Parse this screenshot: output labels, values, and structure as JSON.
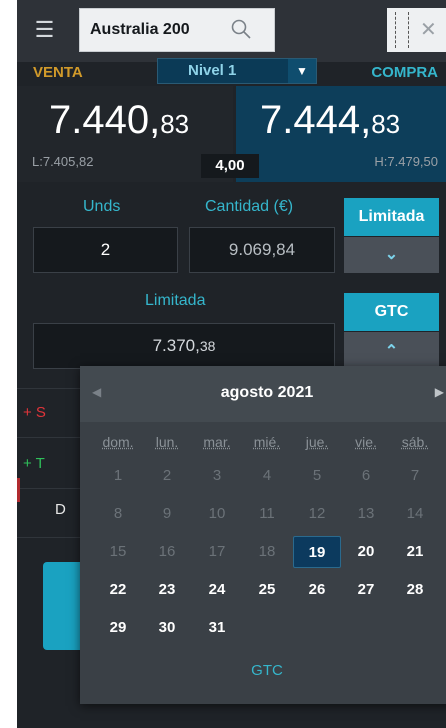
{
  "header": {
    "instrument": "Australia 200"
  },
  "prices": {
    "sell_label": "VENTA",
    "buy_label": "COMPRA",
    "level_label": "Nivel 1",
    "sell_main": "7.440,",
    "sell_small": "83",
    "buy_main": "7.444,",
    "buy_small": "83",
    "low": "L:7.405,82",
    "high": "H:7.479,50",
    "spread": "4,00"
  },
  "form": {
    "units_label": "Unds",
    "units_value": "2",
    "amount_label": "Cantidad (€)",
    "amount_value": "9.069,84",
    "order_type_button": "Limitada",
    "limit_label": "Limitada",
    "limit_value_main": "7.370,",
    "limit_value_small": "38",
    "duration_button": "GTC"
  },
  "background_rows": {
    "row1": "+ S",
    "row2": "+ T",
    "row3": "D"
  },
  "calendar": {
    "title": "agosto 2021",
    "weekdays": [
      "dom.",
      "lun.",
      "mar.",
      "mié.",
      "jue.",
      "vie.",
      "sáb."
    ],
    "weeks": [
      [
        "1",
        "2",
        "3",
        "4",
        "5",
        "6",
        "7"
      ],
      [
        "8",
        "9",
        "10",
        "11",
        "12",
        "13",
        "14"
      ],
      [
        "15",
        "16",
        "17",
        "18",
        "19",
        "20",
        "21"
      ],
      [
        "22",
        "23",
        "24",
        "25",
        "26",
        "27",
        "28"
      ],
      [
        "29",
        "30",
        "31",
        "",
        "",
        "",
        ""
      ]
    ],
    "selected_day": "19",
    "footer": "GTC"
  },
  "colors": {
    "accent": "#1aa2c1",
    "sell": "#d19a2a",
    "buy": "#35b6cc"
  }
}
